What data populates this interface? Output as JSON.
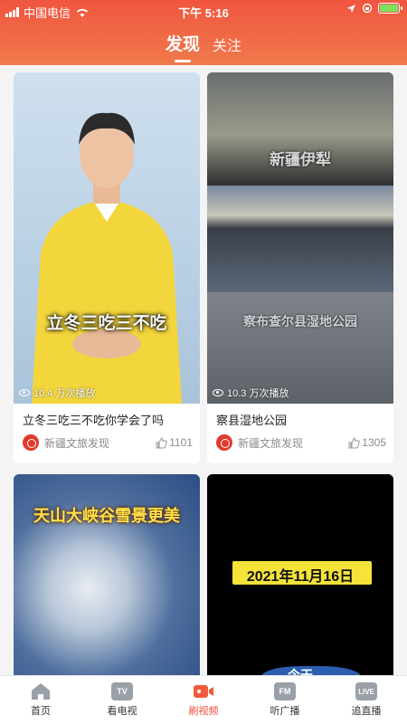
{
  "status_bar": {
    "carrier": "中国电信",
    "time": "下午 5:16"
  },
  "header": {
    "tabs": [
      {
        "label": "发现",
        "active": true
      },
      {
        "label": "关注",
        "active": false
      }
    ]
  },
  "feed": [
    {
      "title": "立冬三吃三不吃你学会了吗",
      "views": "10.4 万次播放",
      "source": "新疆文旅发现",
      "likes": "1101",
      "caption": "立冬三吃三不吃"
    },
    {
      "title": "察县湿地公园",
      "views": "10.3 万次播放",
      "source": "新疆文旅发现",
      "likes": "1305",
      "caption_top": "新疆伊犁",
      "caption_bottom": "察布查尔县湿地公园"
    },
    {
      "caption": "天山大峡谷雪景更美"
    },
    {
      "caption": "2021年11月16日",
      "caption_sub": "今天"
    }
  ],
  "tabbar": [
    {
      "label": "首页",
      "icon": "home-icon",
      "active": false
    },
    {
      "label": "看电视",
      "icon": "tv-icon",
      "icon_text": "TV",
      "active": false
    },
    {
      "label": "刷视频",
      "icon": "video-icon",
      "active": true
    },
    {
      "label": "听广播",
      "icon": "radio-icon",
      "icon_text": "FM",
      "active": false
    },
    {
      "label": "追直播",
      "icon": "live-icon",
      "icon_text": "LIVE",
      "active": false
    }
  ],
  "colors": {
    "accent": "#f04a33",
    "header_start": "#f0553f",
    "header_end": "#f07a4c"
  }
}
